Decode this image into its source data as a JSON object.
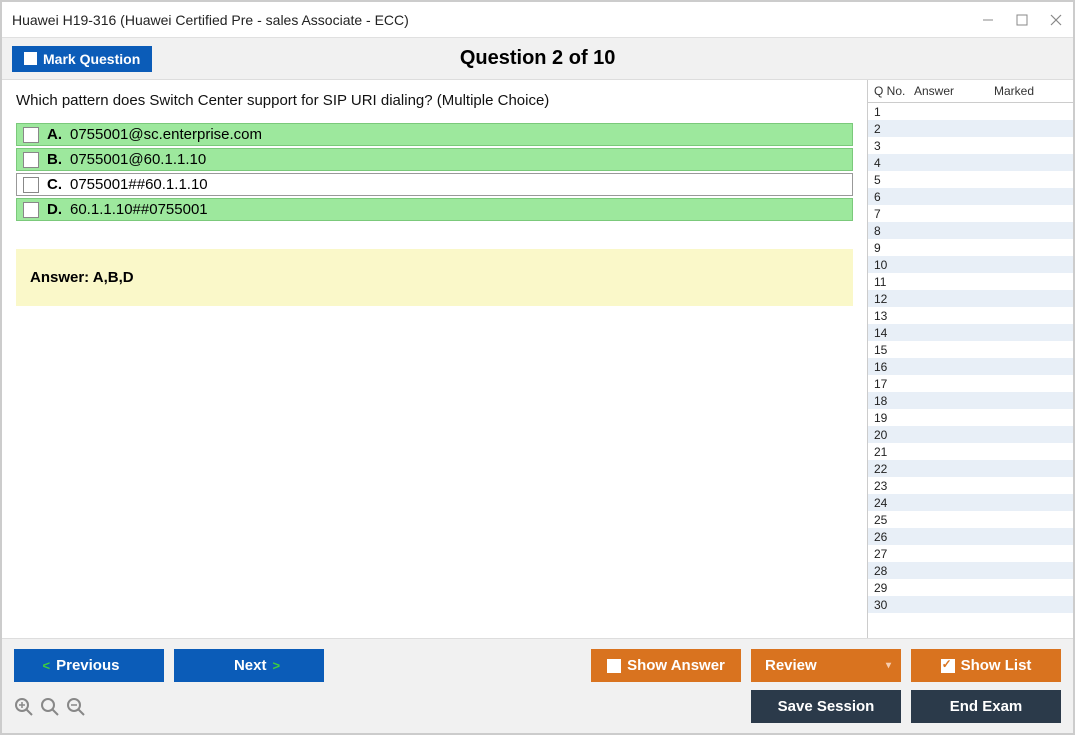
{
  "window": {
    "title": "Huawei H19-316 (Huawei Certified Pre - sales Associate - ECC)"
  },
  "header": {
    "mark_label": "Mark Question",
    "counter": "Question 2 of 10"
  },
  "question": {
    "text": "Which pattern does Switch Center support for SIP URI dialing? (Multiple Choice)",
    "options": [
      {
        "letter": "A.",
        "text": "0755001@sc.enterprise.com",
        "correct": true
      },
      {
        "letter": "B.",
        "text": "0755001@60.1.1.10",
        "correct": true
      },
      {
        "letter": "C.",
        "text": "0755001##60.1.1.10",
        "correct": false
      },
      {
        "letter": "D.",
        "text": "60.1.1.10##0755001",
        "correct": true
      }
    ],
    "answer_label": "Answer: A,B,D"
  },
  "qlist": {
    "headers": {
      "no": "Q No.",
      "answer": "Answer",
      "marked": "Marked"
    },
    "rows": [
      {
        "no": "1"
      },
      {
        "no": "2"
      },
      {
        "no": "3"
      },
      {
        "no": "4"
      },
      {
        "no": "5"
      },
      {
        "no": "6"
      },
      {
        "no": "7"
      },
      {
        "no": "8"
      },
      {
        "no": "9"
      },
      {
        "no": "10"
      },
      {
        "no": "11"
      },
      {
        "no": "12"
      },
      {
        "no": "13"
      },
      {
        "no": "14"
      },
      {
        "no": "15"
      },
      {
        "no": "16"
      },
      {
        "no": "17"
      },
      {
        "no": "18"
      },
      {
        "no": "19"
      },
      {
        "no": "20"
      },
      {
        "no": "21"
      },
      {
        "no": "22"
      },
      {
        "no": "23"
      },
      {
        "no": "24"
      },
      {
        "no": "25"
      },
      {
        "no": "26"
      },
      {
        "no": "27"
      },
      {
        "no": "28"
      },
      {
        "no": "29"
      },
      {
        "no": "30"
      }
    ]
  },
  "footer": {
    "previous": "Previous",
    "next": "Next",
    "show_answer": "Show Answer",
    "review": "Review",
    "show_list": "Show List",
    "save_session": "Save Session",
    "end_exam": "End Exam"
  }
}
